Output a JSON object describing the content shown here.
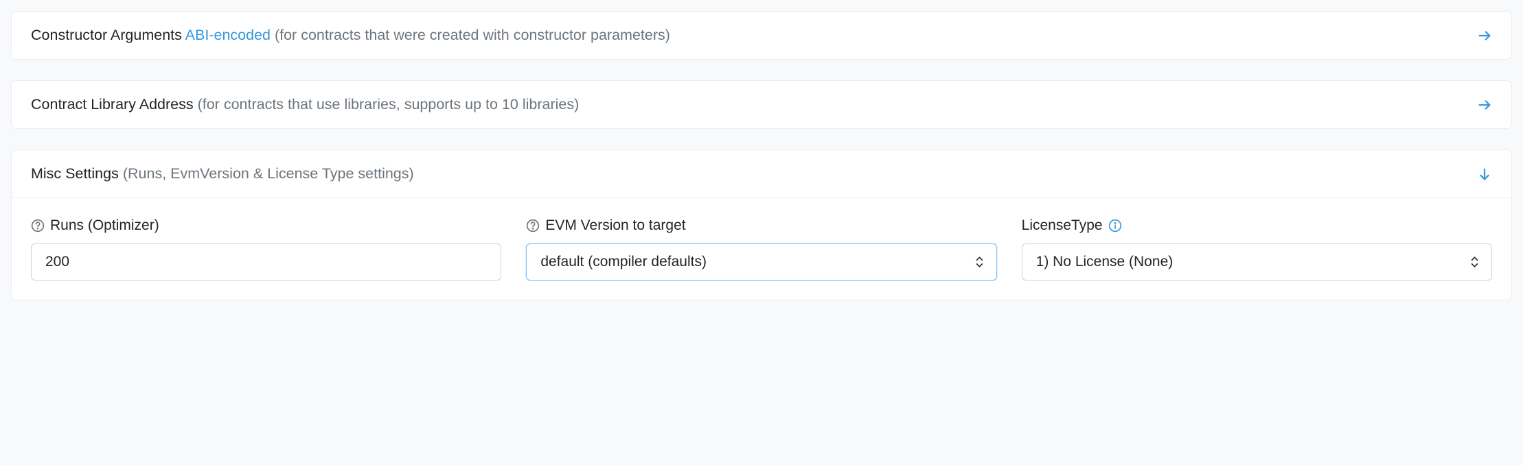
{
  "panels": {
    "constructor": {
      "title": "Constructor Arguments",
      "link_text": "ABI-encoded",
      "subtitle": "(for contracts that were created with constructor parameters)"
    },
    "library": {
      "title": "Contract Library Address",
      "subtitle": "(for contracts that use libraries, supports up to 10 libraries)"
    },
    "misc": {
      "title": "Misc Settings",
      "subtitle": "(Runs, EvmVersion & License Type settings)"
    }
  },
  "misc_form": {
    "runs": {
      "label": "Runs (Optimizer)",
      "value": "200"
    },
    "evm": {
      "label": "EVM Version to target",
      "selected": "default (compiler defaults)"
    },
    "license": {
      "label": "LicenseType",
      "selected": "1) No License (None)"
    }
  }
}
